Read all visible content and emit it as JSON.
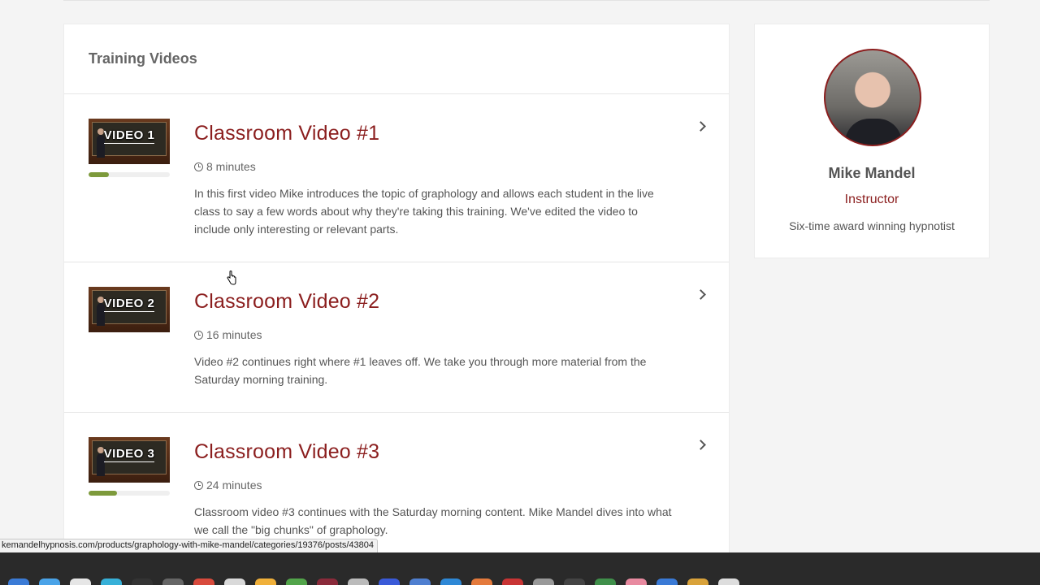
{
  "training": {
    "title": "Training Videos",
    "videos": [
      {
        "thumb_label": "VIDEO 1",
        "title": "Classroom Video #1",
        "duration": "8 minutes",
        "description": "In this first video Mike introduces the topic of graphology and allows each student in the live class to say a few words about why they're taking this training. We've edited the video to include only interesting or relevant parts.",
        "progress": 0.25
      },
      {
        "thumb_label": "VIDEO 2",
        "title": "Classroom Video #2",
        "duration": "16 minutes",
        "description": "Video #2 continues right where #1 leaves off. We take you through more material from the Saturday morning training.",
        "progress": 0
      },
      {
        "thumb_label": "VIDEO 3",
        "title": "Classroom Video #3",
        "duration": "24 minutes",
        "description": "Classroom video #3 continues with the Saturday morning content. Mike Mandel dives into what we call the \"big chunks\" of graphology.",
        "progress": 0.35
      }
    ]
  },
  "instructor": {
    "name": "Mike Mandel",
    "role": "Instructor",
    "bio": "Six-time award winning hypnotist"
  },
  "status_bar": {
    "url": "kemandelhypnosis.com/products/graphology-with-mike-mandel/categories/19376/posts/43804"
  },
  "colors": {
    "accent": "#8b1e1e",
    "progress": "#7d9a3b"
  },
  "icons": {
    "clock": "clock-icon",
    "chevron": "chevron-right-icon",
    "cursor": "hand-pointer-icon"
  }
}
